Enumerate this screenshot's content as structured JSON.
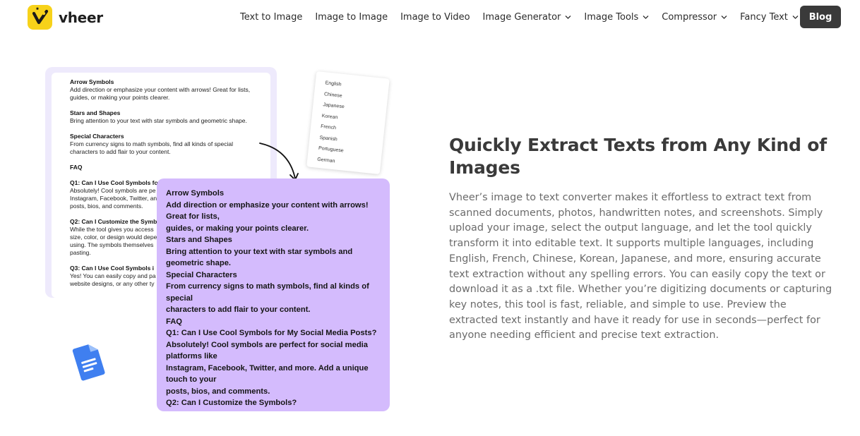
{
  "brand": {
    "name": "vheer",
    "logo_icon": "vheer-logo-icon",
    "accent": "#f7d21a"
  },
  "nav": {
    "items": [
      {
        "label": "Text to Image",
        "dropdown": false
      },
      {
        "label": "Image to Image",
        "dropdown": false
      },
      {
        "label": "Image to Video",
        "dropdown": false
      },
      {
        "label": "Image Generator",
        "dropdown": true
      },
      {
        "label": "Image Tools",
        "dropdown": true
      },
      {
        "label": "Compressor",
        "dropdown": true
      },
      {
        "label": "Fancy Text",
        "dropdown": true
      }
    ],
    "blog_label": "Blog"
  },
  "illustration": {
    "doc_lines": [
      {
        "type": "h",
        "text": "Arrow Symbols"
      },
      {
        "type": "p",
        "text": "Add direction or emphasize your content with arrows! Great for lists,"
      },
      {
        "type": "p",
        "text": "guides, or making your points clearer."
      },
      {
        "type": "gap"
      },
      {
        "type": "h",
        "text": "Stars and Shapes"
      },
      {
        "type": "p",
        "text": "Bring attention to your text with star symbols and geometric shape."
      },
      {
        "type": "gap"
      },
      {
        "type": "h",
        "text": "Special Characters"
      },
      {
        "type": "p",
        "text": "From currency signs to math symbols, find all kinds of special"
      },
      {
        "type": "p",
        "text": "characters to add flair to your content."
      },
      {
        "type": "gap"
      },
      {
        "type": "h",
        "text": "FAQ"
      },
      {
        "type": "gap"
      },
      {
        "type": "h",
        "text": "Q1: Can I Use Cool Symbols for"
      },
      {
        "type": "p",
        "text": "Absolutely! Cool symbols are pe"
      },
      {
        "type": "p",
        "text": "Instagram, Facebook, Twitter, an"
      },
      {
        "type": "p",
        "text": "posts, bios, and comments."
      },
      {
        "type": "gap"
      },
      {
        "type": "h",
        "text": "Q2: Can I Customize the Symb"
      },
      {
        "type": "p",
        "text": "While the tool gives you access"
      },
      {
        "type": "p",
        "text": "size, color, or design would depe"
      },
      {
        "type": "p",
        "text": "using. The symbols themselves"
      },
      {
        "type": "p",
        "text": "pasting."
      },
      {
        "type": "gap"
      },
      {
        "type": "h",
        "text": "Q3: Can I Use Cool Symbols i"
      },
      {
        "type": "p",
        "text": "Yes! You can easily copy and pa"
      },
      {
        "type": "p",
        "text": "website designs, or any other ty"
      }
    ],
    "languages": [
      "English",
      "Chinese",
      "Japanese",
      "Korean",
      "French",
      "Spanish",
      "Portuguese",
      "German"
    ],
    "extracted_lines": [
      "Arrow Symbols",
      "Add direction or emphasize your content with arrows!",
      "Great for lists,",
      "guides, or making your points clearer.",
      "Stars and Shapes",
      "Bring attention to your text with star symbols and",
      "geometric shape.",
      "Special Characters",
      "From currency signs to math symbols, find al kinds of",
      "special",
      "characters to add flair to your content.",
      "FAQ",
      "Q1: Can I Use Cool Symbols for My Social Media Posts?",
      "Absolutely! Cool symbols are perfect for social media",
      "platforms like",
      "Instagram, Facebook, Twitter, and more. Add a unique",
      "touch to your",
      "posts, bios, and comments.",
      "Q2: Can I Customize the Symbols?"
    ],
    "card_color": "#d4bbfd",
    "doc_icon": "google-docs-icon"
  },
  "section": {
    "title": "Quickly Extract Texts from Any Kind of Images",
    "body": "Vheer’s image to text converter makes it effortless to extract text from scanned documents, photos, handwritten notes, and screenshots. Simply upload your image, select the output language, and let the tool quickly transform it into editable text. It supports multiple languages, including English, French, Chinese, Korean, Japanese, and more, ensuring accurate text extraction without any spelling errors. You can easily copy the text or download it as a .txt file. Whether you’re digitizing documents or capturing key notes, this tool is fast, reliable, and simple to use. Preview the extracted text instantly and have it ready for use in seconds—perfect for anyone needing efficient and precise text extraction."
  }
}
